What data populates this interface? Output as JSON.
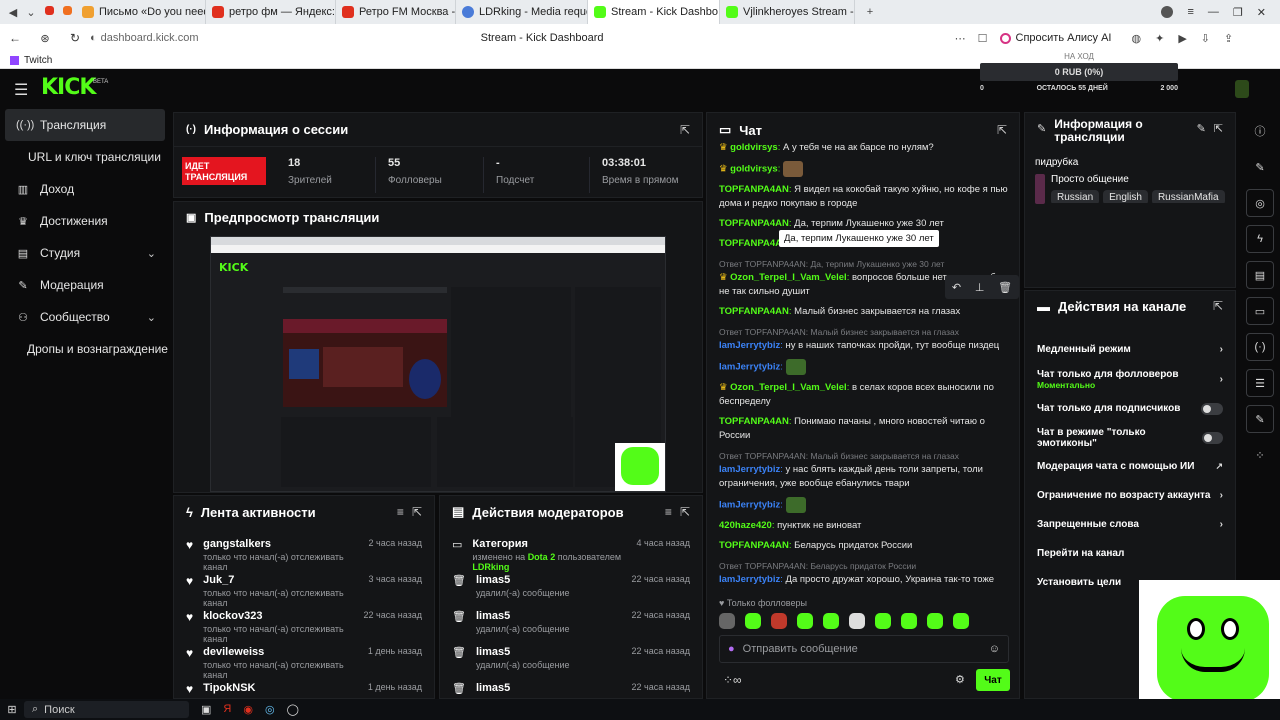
{
  "browser": {
    "tabs": [
      {
        "label": "Письмо «Do you need to ...",
        "color": "#f0a030"
      },
      {
        "label": "ретро фм — Яндекс: наш...",
        "color": "#e0301e"
      },
      {
        "label": "Ретро FM Москва - ...",
        "color": "#e0301e"
      },
      {
        "label": "LDRking - Media request",
        "color": "#4a7bd8"
      },
      {
        "label": "Stream - Kick Dashbo...",
        "color": "#53fc18"
      },
      {
        "label": "Vjlinkheroyes Stream - Wa...",
        "color": "#53fc18"
      }
    ],
    "url": "dashboard.kick.com",
    "page_title": "Stream - Kick Dashboard",
    "alice_label": "Спросить Алису AI",
    "bookmark": "Twitch"
  },
  "wallet": {
    "hint": "НА ХОД",
    "balance": "0 RUB (0%)",
    "left_val": "0",
    "days_left": "ОСТАЛОСЬ 55 ДНЕЙ",
    "right_val": "2 000"
  },
  "logo": {
    "text": "KICK",
    "beta": "BETA"
  },
  "sidebar": {
    "items": [
      {
        "label": "Трансляция",
        "icon": "broadcast-icon"
      },
      {
        "label": "URL и ключ трансляции",
        "icon": ""
      },
      {
        "label": "Доход",
        "icon": "income-icon"
      },
      {
        "label": "Достижения",
        "icon": "trophy-icon"
      },
      {
        "label": "Студия",
        "icon": "studio-icon"
      },
      {
        "label": "Модерация",
        "icon": "wrench-icon"
      },
      {
        "label": "Сообщество",
        "icon": "community-icon"
      },
      {
        "label": "Дропы и вознаграждение",
        "icon": ""
      }
    ]
  },
  "session": {
    "title": "Информация о сессии",
    "live_badge": "ИДЕТ ТРАНСЛЯЦИЯ",
    "stats": [
      {
        "value": "18",
        "label": "Зрителей"
      },
      {
        "value": "55",
        "label": "Фолловеры"
      },
      {
        "value": "-",
        "label": "Подсчет"
      },
      {
        "value": "03:38:01",
        "label": "Время в прямом"
      }
    ]
  },
  "preview": {
    "title": "Предпросмотр трансляции"
  },
  "activity": {
    "title": "Лента активности",
    "items": [
      {
        "name": "gangstalkers",
        "sub": "только что начал(-а) отслеживать канал",
        "time": "2 часа назад"
      },
      {
        "name": "Juk_7",
        "sub": "только что начал(-а) отслеживать канал",
        "time": "3 часа назад"
      },
      {
        "name": "klockov323",
        "sub": "только что начал(-а) отслеживать канал",
        "time": "22 часа назад"
      },
      {
        "name": "devileweiss",
        "sub": "только что начал(-а) отслеживать канал",
        "time": "1 день назад"
      },
      {
        "name": "TipokNSK",
        "sub": "",
        "time": "1 день назад"
      }
    ]
  },
  "modactions": {
    "title": "Действия модераторов",
    "items": [
      {
        "name": "Категория",
        "sub_pre": "изменено на ",
        "sub_game": "Dota 2",
        "sub_mid": " пользователем ",
        "sub_user": "LDRking",
        "time": "4 часа назад"
      },
      {
        "name": "limas5",
        "sub_pre": "удалил(-а) сообщение",
        "time": "22 часа назад"
      },
      {
        "name": "limas5",
        "sub_pre": "удалил(-а) сообщение",
        "time": "22 часа назад"
      },
      {
        "name": "limas5",
        "sub_pre": "удалил(-а) сообщение",
        "time": "22 часа назад"
      },
      {
        "name": "limas5",
        "sub_pre": "",
        "time": "22 часа назад"
      }
    ]
  },
  "chat": {
    "title": "Чат",
    "messages": [
      {
        "user": "goldvirsys",
        "text": "А у тебя че на ак барсе по нулям?",
        "color": "#53fc18",
        "crown": true
      },
      {
        "user": "goldvirsys",
        "text": "",
        "color": "#53fc18",
        "crown": true,
        "emote": true
      },
      {
        "user": "TOPFANPA4AN",
        "text": "Я видел на кокобай такую хуйню, но кофе я пью дома и редко покупаю в городе",
        "color": "#53fc18"
      },
      {
        "user": "TOPFANPA4AN",
        "text": "Да, терпим Лукашенко уже 30 лет",
        "color": "#53fc18"
      },
      {
        "user": "TOPFANPA4AN",
        "text": "",
        "color": "#53fc18"
      },
      {
        "reply": "Ответ TOPFANPA4AN: Да, терпим Лукашенко уже 30 лет",
        "user": "Ozon_Terpel_I_Vam_Velel",
        "text": "вопросов больше нет, но когда бы не так сильно душит",
        "color": "#53fc18",
        "crown": true
      },
      {
        "user": "TOPFANPA4AN",
        "text": "Малый бизнес закрывается на глазах",
        "color": "#53fc18"
      },
      {
        "reply": "Ответ TOPFANPA4AN: Малый бизнес закрывается на глазах",
        "user": "IamJerrytybiz",
        "text": "ну в наших тапочках пройди, тут вообще пиздец",
        "color": "#3b82f6"
      },
      {
        "user": "IamJerrytybiz",
        "text": "",
        "color": "#3b82f6",
        "emote": true
      },
      {
        "user": "Ozon_Terpel_I_Vam_Velel",
        "text": "в селах коров всех выносили по беспределу",
        "color": "#53fc18",
        "crown": true
      },
      {
        "user": "TOPFANPA4AN",
        "text": "Понимаю пачаны , много новостей читаю о России",
        "color": "#53fc18"
      },
      {
        "reply": "Ответ TOPFANPA4AN: Малый бизнес закрывается на глазах",
        "user": "IamJerrytybiz",
        "text": "у нас блять каждый день толи запреты, толи ограничения, уже вообще ебанулись твари",
        "color": "#3b82f6"
      },
      {
        "user": "IamJerrytybiz",
        "text": "",
        "color": "#3b82f6",
        "emote": true
      },
      {
        "user": "420haze420",
        "text": "пунктик не виноват",
        "color": "#53fc18"
      },
      {
        "user": "TOPFANPA4AN",
        "text": "Беларусь придаток России",
        "color": "#53fc18"
      },
      {
        "reply": "Ответ TOPFANPA4AN: Беларусь придаток России",
        "user": "IamJerrytybiz",
        "text": "Да просто дружат хорошо, Украина так-то тоже была, но проебал один додик",
        "color": "#3b82f6"
      }
    ],
    "tooltip": "Да, терпим Лукашенко уже 30 лет",
    "followers_only": "Только фолловеры",
    "input_placeholder": "Отправить сообщение",
    "send_label": "Чат"
  },
  "channel_info": {
    "title": "Информация о трансляции",
    "stream_title": "пидрубка",
    "category": "Просто общение",
    "tags": [
      "Russian",
      "English",
      "RussianMafia"
    ]
  },
  "channel_actions": {
    "title": "Действия на канале",
    "items": [
      {
        "label": "Медленный режим",
        "control": "chevron"
      },
      {
        "label": "Чат только для фолловеров",
        "sub": "Моментально",
        "control": "chevron"
      },
      {
        "label": "Чат только для подписчиков",
        "control": "toggle"
      },
      {
        "label": "Чат в режиме \"только эмотиконы\"",
        "control": "toggle"
      },
      {
        "label": "Модерация чата с помощью ИИ",
        "control": "external"
      },
      {
        "label": "Ограничение по возрасту аккаунта",
        "control": "chevron"
      },
      {
        "label": "Запрещенные слова",
        "control": "chevron"
      },
      {
        "label": "Перейти на канал",
        "control": "none"
      },
      {
        "label": "Установить цели",
        "control": "chevron"
      }
    ]
  },
  "taskbar": {
    "search_placeholder": "Поиск"
  },
  "colors": {
    "accent": "#53fc18",
    "live": "#e4151f",
    "panel": "#141517"
  }
}
